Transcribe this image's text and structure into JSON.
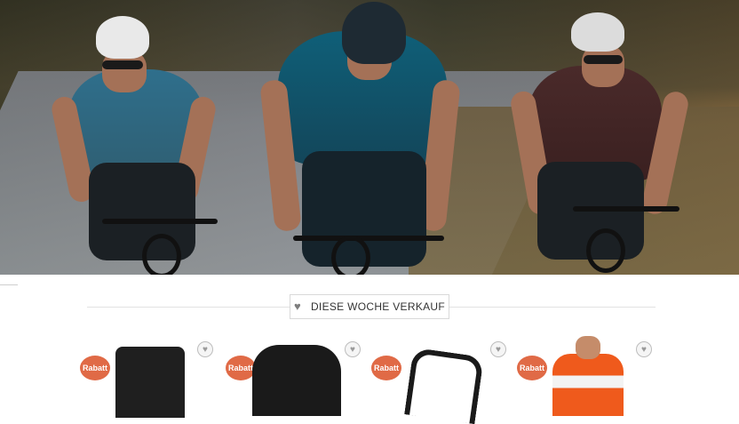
{
  "hero": {
    "image_alt": ""
  },
  "section": {
    "title": "DIESE WOCHE VERKAUF",
    "icon": "heart-icon"
  },
  "products": [
    {
      "badge": "Rabatt",
      "kind": "bib-shorts"
    },
    {
      "badge": "Rabatt",
      "kind": "protective-jacket"
    },
    {
      "badge": "Rabatt",
      "kind": "bottle-cage"
    },
    {
      "badge": "Rabatt",
      "kind": "orange-jersey"
    }
  ],
  "colors": {
    "sale_badge": "#e06a46",
    "wishlist_border": "#bdbdbd",
    "divider": "#e2e2e2"
  }
}
